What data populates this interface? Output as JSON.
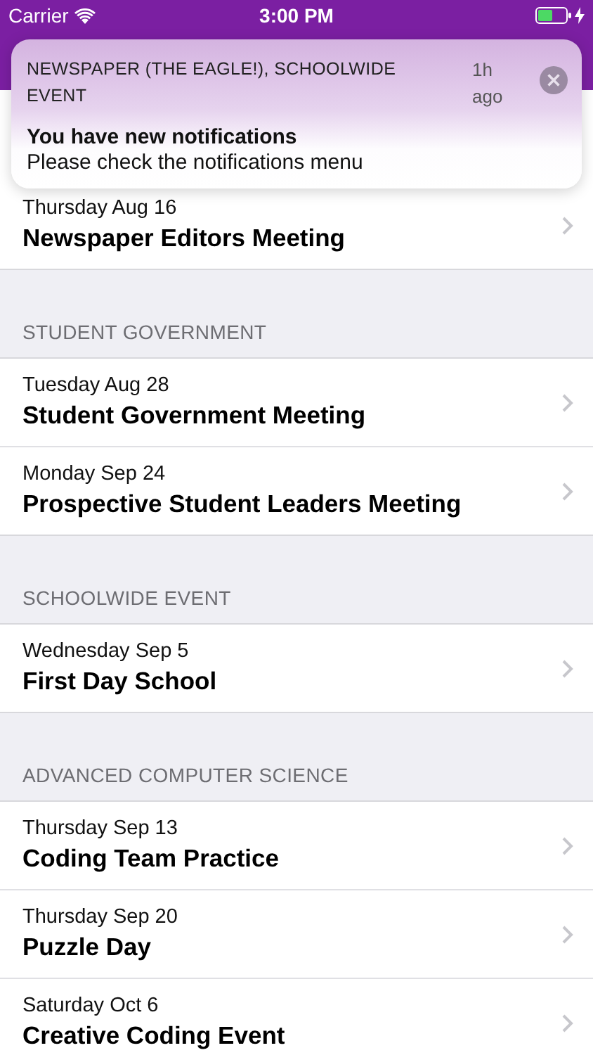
{
  "status_bar": {
    "carrier": "Carrier",
    "time": "3:00 PM"
  },
  "notification": {
    "source": "NEWSPAPER (THE EAGLE!), SCHOOLWIDE EVENT",
    "age": "1h ago",
    "title": "You have new notifications",
    "body": "Please check the notifications menu"
  },
  "sections": [
    {
      "events": [
        {
          "date": "Thursday Aug 16",
          "title": "Newspaper Editors Meeting"
        }
      ]
    },
    {
      "header": "STUDENT GOVERNMENT",
      "events": [
        {
          "date": "Tuesday Aug 28",
          "title": "Student Government Meeting"
        },
        {
          "date": "Monday Sep 24",
          "title": "Prospective Student Leaders Meeting"
        }
      ]
    },
    {
      "header": "SCHOOLWIDE EVENT",
      "events": [
        {
          "date": "Wednesday Sep 5",
          "title": "First Day School"
        }
      ]
    },
    {
      "header": "ADVANCED COMPUTER SCIENCE",
      "events": [
        {
          "date": "Thursday Sep 13",
          "title": "Coding Team Practice"
        },
        {
          "date": "Thursday Sep 20",
          "title": "Puzzle Day"
        },
        {
          "date": "Saturday Oct 6",
          "title": "Creative Coding Event"
        }
      ]
    }
  ]
}
